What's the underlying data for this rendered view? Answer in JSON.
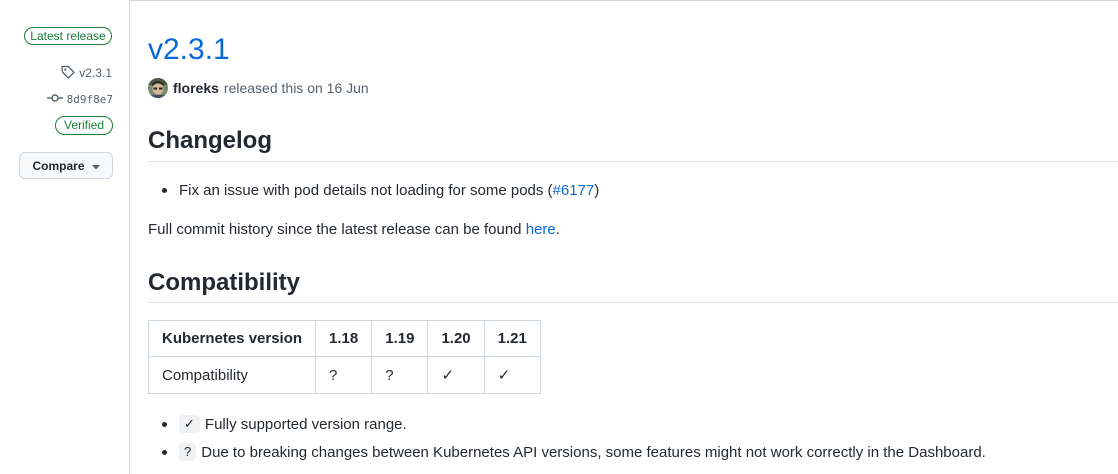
{
  "sidebar": {
    "latest_badge": "Latest release",
    "tag_name": "v2.3.1",
    "commit_sha": "8d9f8e7",
    "verified_badge": "Verified",
    "compare_label": "Compare"
  },
  "release": {
    "title": "v2.3.1",
    "author": "floreks",
    "meta_text": "released this on 16 Jun"
  },
  "changelog": {
    "heading": "Changelog",
    "items": [
      {
        "text": "Fix an issue with pod details not loading for some pods (",
        "link": "#6177",
        "suffix": ")"
      }
    ],
    "history_text": "Full commit history since the latest release can be found ",
    "history_link": "here",
    "history_suffix": "."
  },
  "compatibility": {
    "heading": "Compatibility",
    "table": {
      "headers": [
        "Kubernetes version",
        "1.18",
        "1.19",
        "1.20",
        "1.21"
      ],
      "row": [
        "Compatibility",
        "?",
        "?",
        "✓",
        "✓"
      ]
    },
    "legend": [
      {
        "symbol": "✓",
        "text": "Fully supported version range."
      },
      {
        "symbol": "?",
        "text": "Due to breaking changes between Kubernetes API versions, some features might not work correctly in the Dashboard."
      }
    ]
  },
  "icons": {
    "tag": "tag-icon",
    "commit": "git-commit-icon",
    "caret": "caret-down-icon"
  },
  "colors": {
    "accent": "#0969da",
    "success": "#1a7f37",
    "border": "#d0d7de"
  }
}
